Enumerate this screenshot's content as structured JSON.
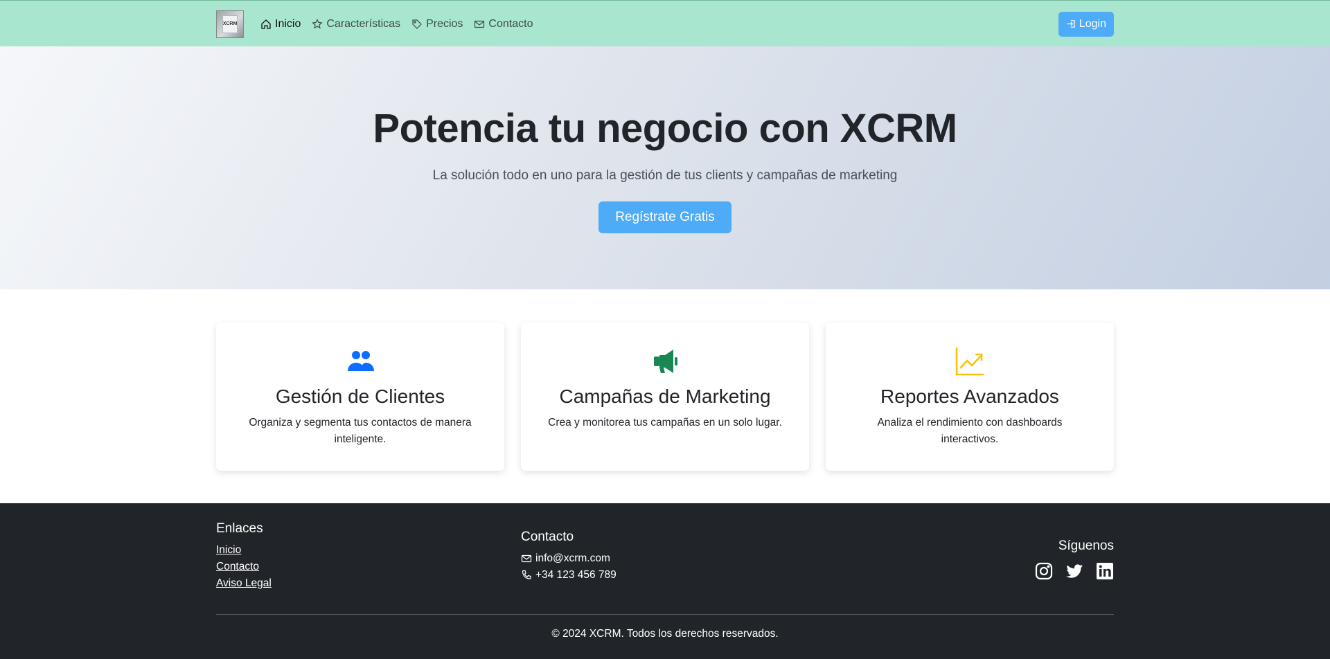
{
  "navbar": {
    "logo_text": "XCRM",
    "links": [
      {
        "label": "Inicio",
        "icon": "home-icon"
      },
      {
        "label": "Características",
        "icon": "star-icon"
      },
      {
        "label": "Precios",
        "icon": "tag-icon"
      },
      {
        "label": "Contacto",
        "icon": "envelope-icon"
      }
    ],
    "login_label": "Login"
  },
  "hero": {
    "title": "Potencia tu negocio con XCRM",
    "subtitle": "La solución todo en uno para la gestión de tus clients y campañas de marketing",
    "cta_label": "Regístrate Gratis"
  },
  "features": [
    {
      "icon": "people-icon",
      "title": "Gestión de Clientes",
      "text": "Organiza y segmenta tus contactos de manera inteligente.",
      "color": "#0d6efd"
    },
    {
      "icon": "megaphone-icon",
      "title": "Campañas de Marketing",
      "text": "Crea y monitorea tus campañas en un solo lugar.",
      "color": "#198754"
    },
    {
      "icon": "graph-up-icon",
      "title": "Reportes Avanzados",
      "text": "Analiza el rendimiento con dashboards interactivos.",
      "color": "#ffc107"
    }
  ],
  "footer": {
    "links_title": "Enlaces",
    "links": [
      "Inicio",
      "Contacto",
      "Aviso Legal"
    ],
    "contact_title": "Contacto",
    "email": "info@xcrm.com",
    "phone": "+34 123 456 789",
    "social_title": "Síguenos",
    "socials": [
      "instagram-icon",
      "twitter-icon",
      "linkedin-icon"
    ],
    "copyright": "© 2024 XCRM. Todos los derechos reservados."
  },
  "colors": {
    "navbar_bg": "#a8e6cf",
    "accent": "#4dabf7",
    "footer_bg": "#212529"
  }
}
